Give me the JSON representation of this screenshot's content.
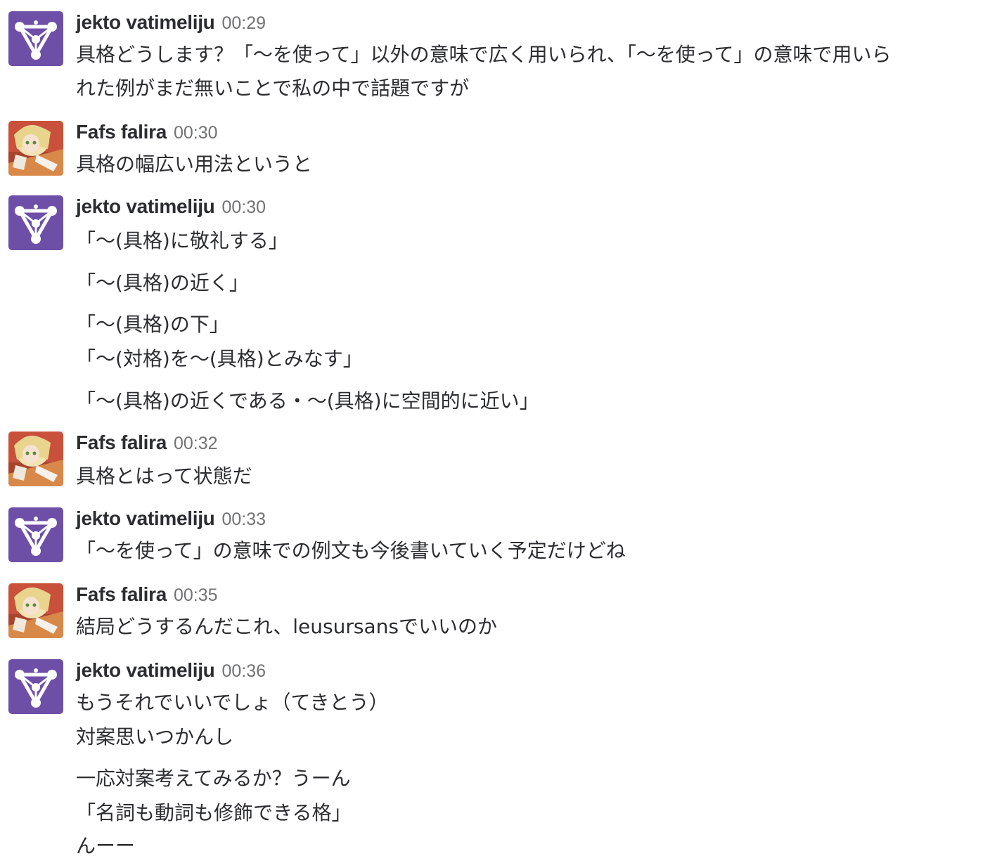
{
  "users": {
    "jekto": {
      "name": "jekto vatimeliju",
      "avatar_icon": "triangle-emblem-icon",
      "avatar_color": "#6e4fa8"
    },
    "fafs": {
      "name": "Fafs falira",
      "avatar_icon": "anime-portrait-icon"
    }
  },
  "messages": [
    {
      "author": "jekto vatimeliju",
      "time": "00:29",
      "lines": [
        "具格どうします？「〜を使って」以外の意味で広く用いられ、「〜を使って」の意味で用いら",
        "れた例がまだ無いことで私の中で話題ですが"
      ]
    },
    {
      "author": "Fafs falira",
      "time": "00:30",
      "lines": [
        "具格の幅広い用法というと"
      ]
    },
    {
      "author": "jekto vatimeliju",
      "time": "00:30",
      "lines": [
        "「〜(具格)に敬礼する」",
        "「〜(具格)の近く」",
        "「〜(具格)の下」",
        "「〜(対格)を〜(具格)とみなす」",
        "「〜(具格)の近くである・〜(具格)に空間的に近い」"
      ]
    },
    {
      "author": "Fafs falira",
      "time": "00:32",
      "lines": [
        "具格とはって状態だ"
      ]
    },
    {
      "author": "jekto vatimeliju",
      "time": "00:33",
      "lines": [
        "「〜を使って」の意味での例文も今後書いていく予定だけどね"
      ]
    },
    {
      "author": "Fafs falira",
      "time": "00:35",
      "lines": [
        "結局どうするんだこれ、leusursansでいいのか"
      ]
    },
    {
      "author": "jekto vatimeliju",
      "time": "00:36",
      "lines": [
        "もうそれでいいでしょ（てきとう）",
        "対案思いつかんし",
        "一応対案考えてみるか？うーん",
        "「名詞も動詞も修飾できる格」",
        "んーー"
      ]
    }
  ]
}
